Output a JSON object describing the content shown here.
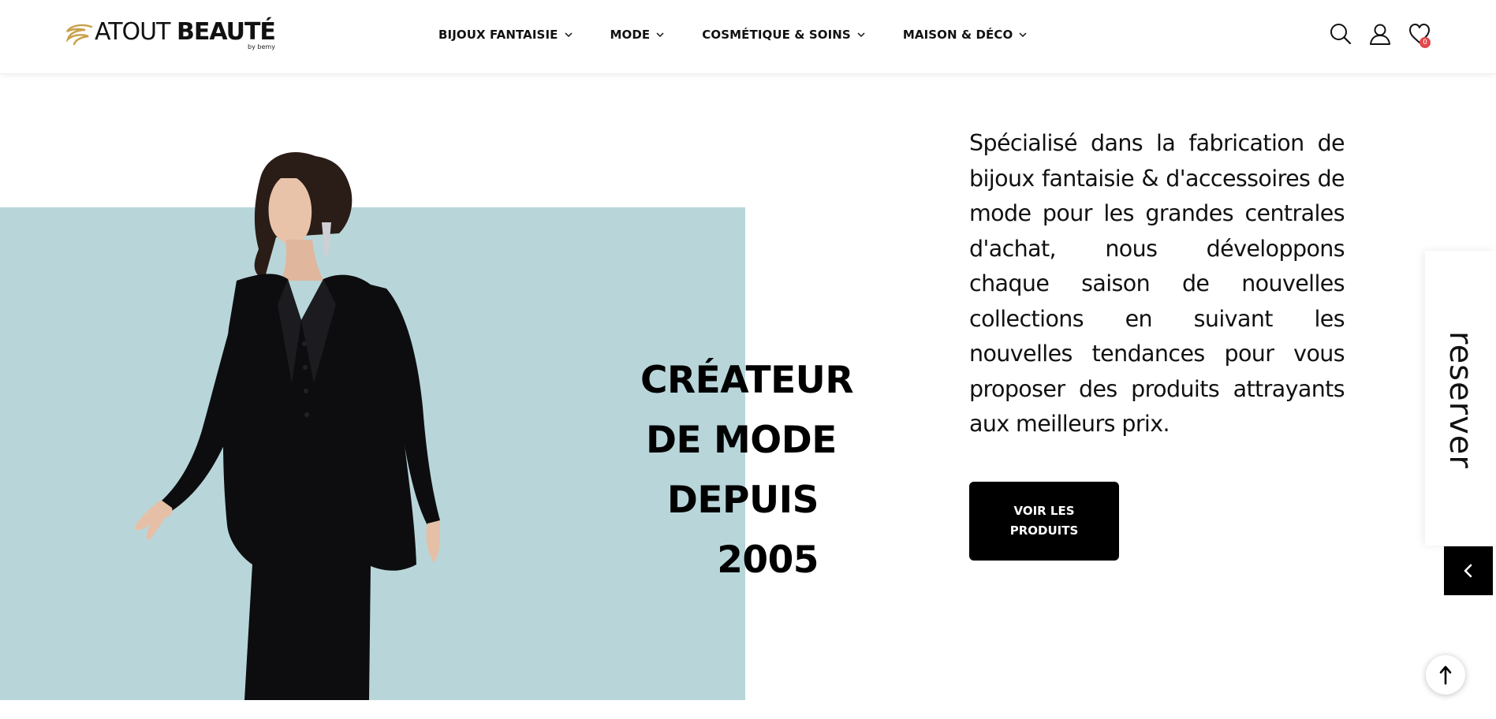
{
  "brand": {
    "logo_light": "ATOUT ",
    "logo_bold": "BEAUTÉ",
    "logo_sub": "by bemy",
    "accent_color": "#c9a14a"
  },
  "nav": {
    "items": [
      {
        "label": "BIJOUX FANTAISIE",
        "icon": "chevron-down-icon"
      },
      {
        "label": "MODE",
        "icon": "chevron-down-icon"
      },
      {
        "label": "COSMÉTIQUE & SOINS",
        "icon": "chevron-down-icon"
      },
      {
        "label": "MAISON & DÉCO",
        "icon": "chevron-down-icon"
      }
    ]
  },
  "header_icons": {
    "search": "search-icon",
    "account": "user-icon",
    "wishlist": "heart-icon",
    "wishlist_count": "0",
    "badge_color": "#e2474b"
  },
  "hero": {
    "headline": [
      "CRÉATEUR",
      "DE MODE",
      "DEPUIS",
      "2005"
    ],
    "description": "Spécialisé dans la fabrication de bijoux fantaisie & d'accessoires de mode pour les grandes centrales d'achat, nous développons chaque saison de nouvelles collections en suivant les nouvelles tendances pour vous proposer des produits attrayants aux meilleurs prix.",
    "cta_label": "VOIR LES PRODUITS",
    "panel_color": "#b8d6da"
  },
  "side_widget": {
    "label": "reserver",
    "collapse_icon": "chevron-left-icon"
  },
  "scroll_top": {
    "icon": "arrow-up-icon"
  }
}
